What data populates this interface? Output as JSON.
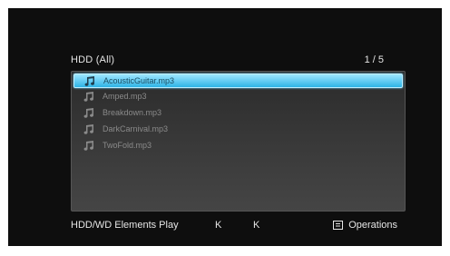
{
  "header": {
    "title": "HDD (All)",
    "page": "1 / 5"
  },
  "files": [
    {
      "name": "AcousticGuitar.mp3",
      "selected": true,
      "icon": "music-note-icon"
    },
    {
      "name": "Amped.mp3",
      "selected": false,
      "icon": "music-note-icon"
    },
    {
      "name": "Breakdown.mp3",
      "selected": false,
      "icon": "music-note-icon"
    },
    {
      "name": "DarkCarnival.mp3",
      "selected": false,
      "icon": "music-note-icon"
    },
    {
      "name": "TwoFold.mp3",
      "selected": false,
      "icon": "music-note-icon"
    }
  ],
  "footer": {
    "title": "HDD/WD Elements Play",
    "k1": "K",
    "k2": "K",
    "operations": "Operations",
    "operations_icon": "options-menu-icon"
  },
  "colors": {
    "background": "#0e0e0e",
    "selection": "#2eb4e6",
    "text": "#e6e6e6"
  }
}
